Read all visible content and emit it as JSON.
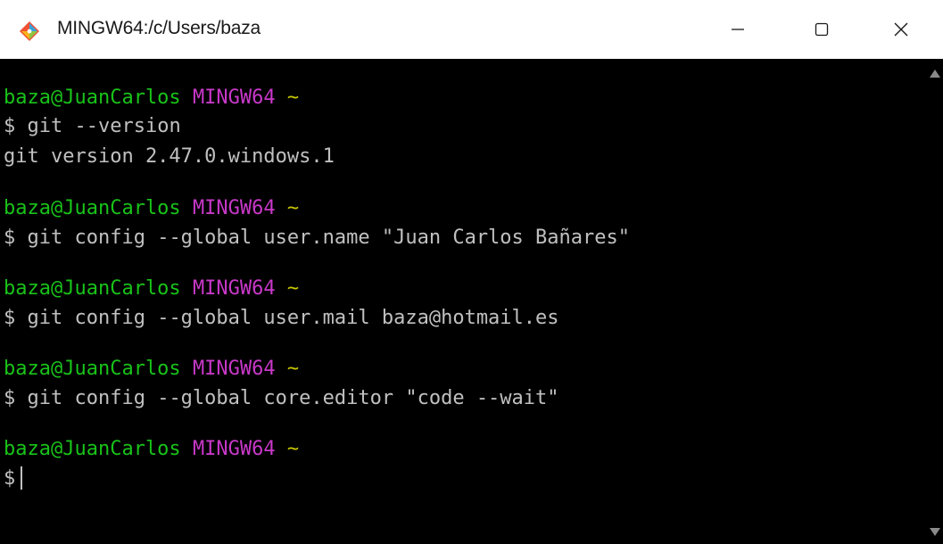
{
  "window": {
    "title": "MINGW64:/c/Users/baza",
    "minimize_glyph": "—",
    "close_glyph": "✕"
  },
  "colors": {
    "prompt_user": "#19c319",
    "prompt_env": "#c838c8",
    "prompt_tilde": "#c8c800",
    "text": "#c0c0c0",
    "background": "#000000"
  },
  "terminal": {
    "prompt": {
      "user_host": "baza@JuanCarlos",
      "env": "MINGW64",
      "dir": "~",
      "symbol": "$"
    },
    "blocks": [
      {
        "command": "git --version",
        "output": "git version 2.47.0.windows.1"
      },
      {
        "command": "git config --global user.name \"Juan Carlos Bañares\""
      },
      {
        "command": "git config --global user.mail baza@hotmail.es"
      },
      {
        "command": "git config --global core.editor \"code --wait\""
      }
    ]
  }
}
